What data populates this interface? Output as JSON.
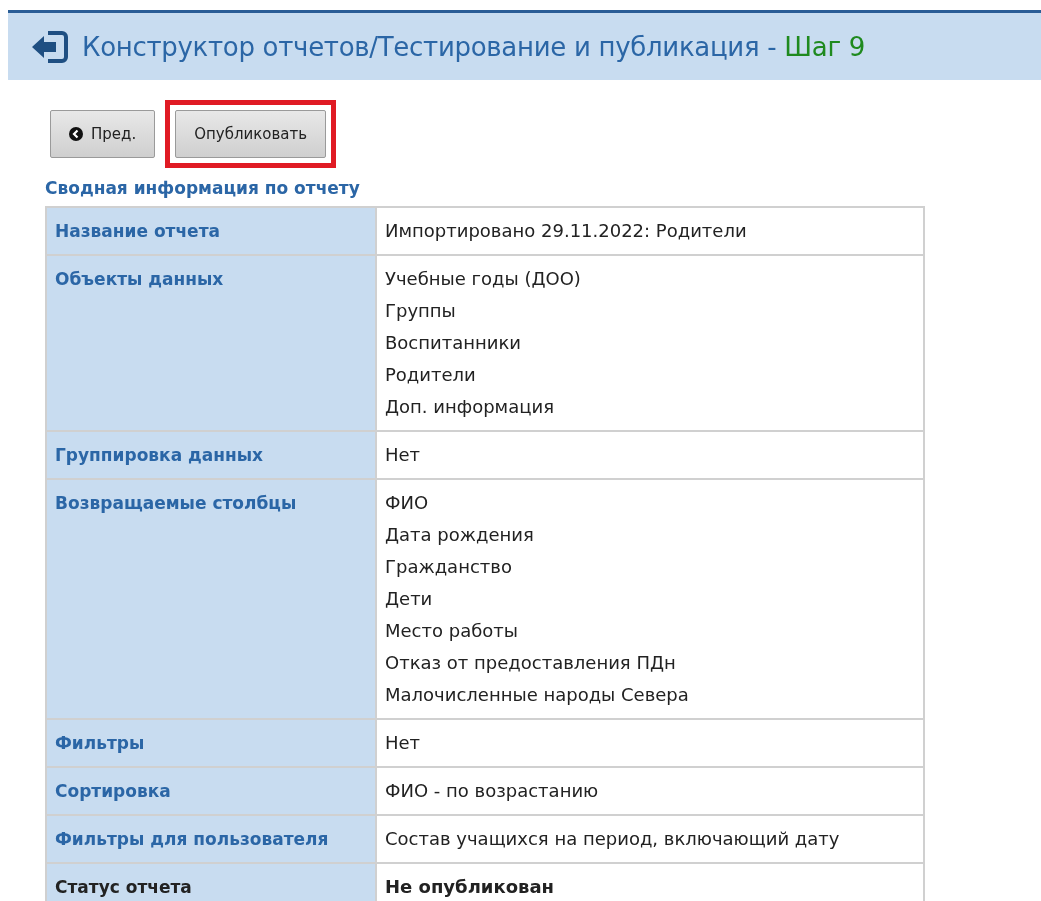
{
  "header": {
    "title": "Конструктор отчетов/Тестирование и публикация - ",
    "step": "Шаг 9"
  },
  "buttons": [
    {
      "kind": "prev",
      "label": "Пред.",
      "highlighted": false
    },
    {
      "kind": "plain",
      "label": "Опубликовать",
      "highlighted": true
    }
  ],
  "section_title": "Сводная информация по отчету",
  "summary": [
    {
      "kind": "normal",
      "label": "Название отчета",
      "values": [
        "Импортировано 29.11.2022: Родители"
      ]
    },
    {
      "kind": "normal",
      "label": "Объекты данных",
      "values": [
        "Учебные годы (ДОО)",
        "Группы",
        "Воспитанники",
        "Родители",
        "Доп. информация"
      ]
    },
    {
      "kind": "normal",
      "label": "Группировка данных",
      "values": [
        "Нет"
      ]
    },
    {
      "kind": "normal",
      "label": "Возвращаемые столбцы",
      "values": [
        "ФИО",
        "Дата рождения",
        "Гражданство",
        "Дети",
        "Место работы",
        "Отказ от предоставления ПДн",
        "Малочисленные народы Севера"
      ]
    },
    {
      "kind": "normal",
      "label": "Фильтры",
      "values": [
        "Нет"
      ]
    },
    {
      "kind": "normal",
      "label": "Сортировка",
      "values": [
        "ФИО - по возрастанию"
      ]
    },
    {
      "kind": "normal",
      "label": "Фильтры для пользователя",
      "values": [
        "Состав учащихся на период, включающий дату"
      ]
    },
    {
      "kind": "status",
      "label": "Статус отчета",
      "values": [
        "Не опубликован"
      ]
    }
  ]
}
